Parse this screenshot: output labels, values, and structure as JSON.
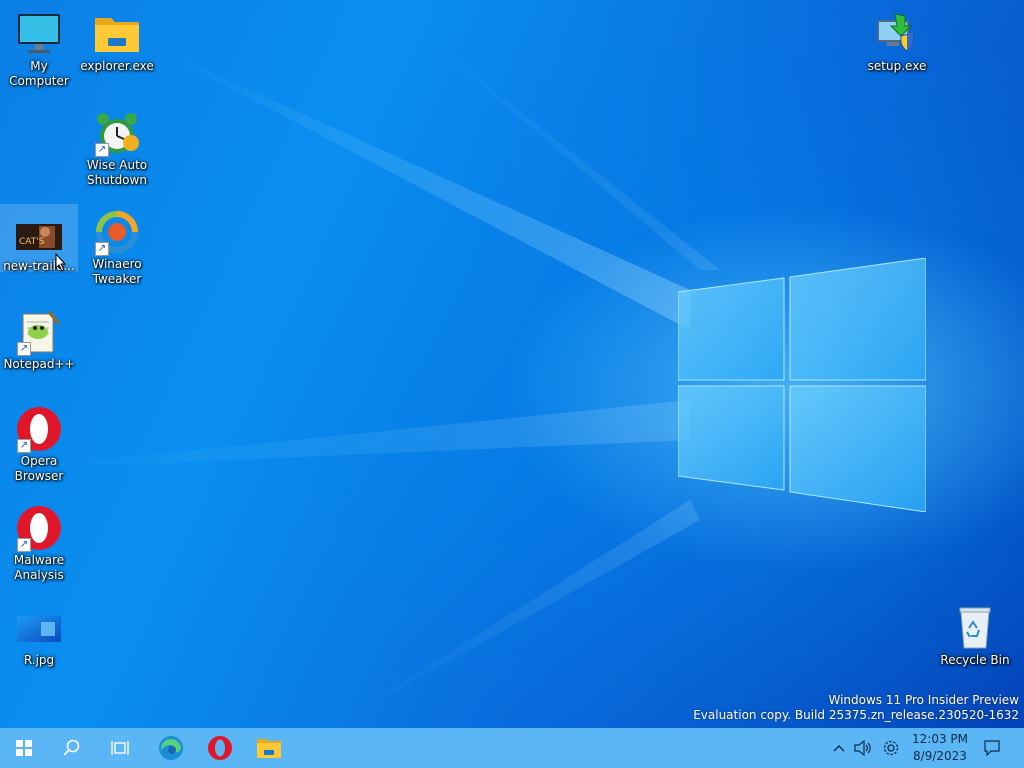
{
  "desktop": {
    "icons": [
      {
        "label": "My Computer",
        "icon": "monitor-icon"
      },
      {
        "label": "explorer.exe",
        "icon": "folder-icon"
      },
      {
        "label": "setup.exe",
        "icon": "installer-icon"
      },
      {
        "label": "Wise Auto Shutdown",
        "icon": "alarm-clock-icon"
      },
      {
        "label": "new-traile...",
        "icon": "video-thumbnail-icon"
      },
      {
        "label": "Winaero Tweaker",
        "icon": "winaero-icon"
      },
      {
        "label": "Notepad++",
        "icon": "notepadpp-icon"
      },
      {
        "label": "Opera Browser",
        "icon": "opera-icon"
      },
      {
        "label": "Malware Analysis",
        "icon": "opera-icon"
      },
      {
        "label": "R.jpg",
        "icon": "image-thumbnail-icon"
      },
      {
        "label": "Recycle Bin",
        "icon": "recycle-bin-icon"
      }
    ],
    "watermark": {
      "line1": "Windows 11 Pro Insider Preview",
      "line2": "Evaluation copy. Build 25375.zn_release.230520-1632"
    }
  },
  "taskbar": {
    "pinned": [
      "start-icon",
      "search-icon",
      "task-view-icon",
      "edge-icon",
      "opera-icon",
      "file-explorer-icon"
    ],
    "tray": [
      "chevron-up-icon",
      "volume-icon",
      "settings-gear-icon",
      "notification-icon"
    ],
    "clock": {
      "time": "12:03 PM",
      "date": "8/9/2023"
    }
  },
  "colors": {
    "taskbar": "#5ab6f5",
    "wallpaper": "#0a7ae6"
  }
}
